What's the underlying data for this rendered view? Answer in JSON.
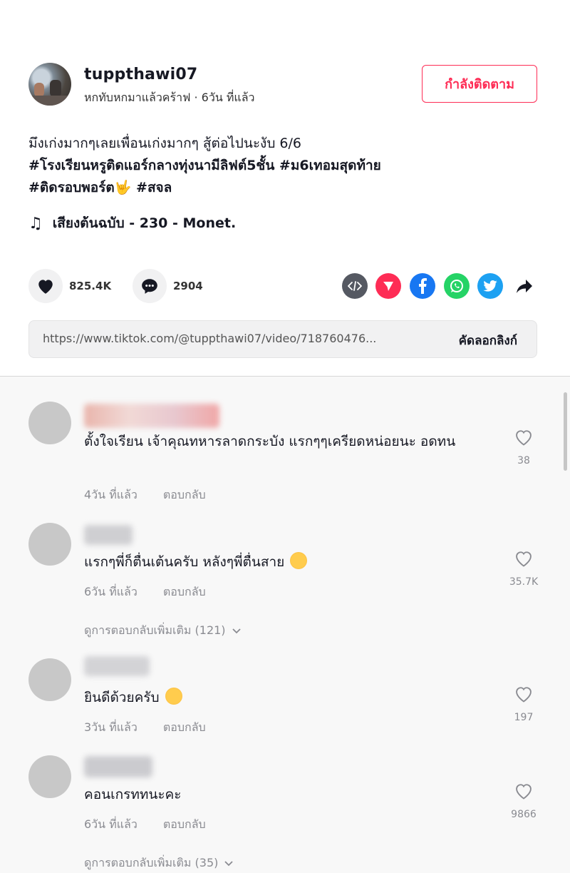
{
  "author": {
    "username": "tuppthawi07",
    "subline": "หกทับหกมาแล้วคร้าฟ · 6วัน ที่แล้ว",
    "follow_label": "กำลังติดตาม"
  },
  "caption": {
    "text": "มึงเก่งมากๆเลยเพื่อนเก่งมากๆ สู้ต่อไปนะงับ 6/6",
    "tags_line1": "#โรงเรียนหรูติดแอร์กลางทุ่งนามีลิฟต์5ชั้น #ม6เทอมสุดท้าย",
    "tags_line2": "#ติดรอบพอร์ต🤟 #สจล"
  },
  "music": {
    "title": "เสียงต้นฉบับ - 230 - Monet."
  },
  "stats": {
    "likes": "825.4K",
    "comments": "2904"
  },
  "share_icons": [
    "embed-icon",
    "send-icon",
    "facebook-icon",
    "whatsapp-icon",
    "twitter-icon",
    "share-arrow-icon"
  ],
  "link": {
    "url": "https://www.tiktok.com/@tuppthawi07/video/718760476...",
    "copy_label": "คัดลอกลิงก์"
  },
  "comments": [
    {
      "text": "ตั้งใจเรียน เจ้าคุณทหารลาดกระบัง แรกๆๆเครียดหน่อยนะ อดทน",
      "time": "4วัน ที่แล้ว",
      "reply_label": "ตอบกลับ",
      "likes": "38"
    },
    {
      "text": "แรกๆพี่ก็ตื่นเต้นครับ หลังๆพี่ตื่นสาย",
      "time": "6วัน ที่แล้ว",
      "reply_label": "ตอบกลับ",
      "likes": "35.7K",
      "more_replies": "ดูการตอบกลับเพิ่มเติม (121)"
    },
    {
      "text": "ยินดีด้วยครับ",
      "time": "3วัน ที่แล้ว",
      "reply_label": "ตอบกลับ",
      "likes": "197"
    },
    {
      "text": "คอนเกรททนะคะ",
      "time": "6วัน ที่แล้ว",
      "reply_label": "ตอบกลับ",
      "likes": "9866",
      "more_replies": "ดูการตอบกลับเพิ่มเติม (35)"
    }
  ],
  "colors": {
    "accent": "#fe2c55",
    "muted": "#8a8b91",
    "comments_bg": "#f8f8f8"
  }
}
